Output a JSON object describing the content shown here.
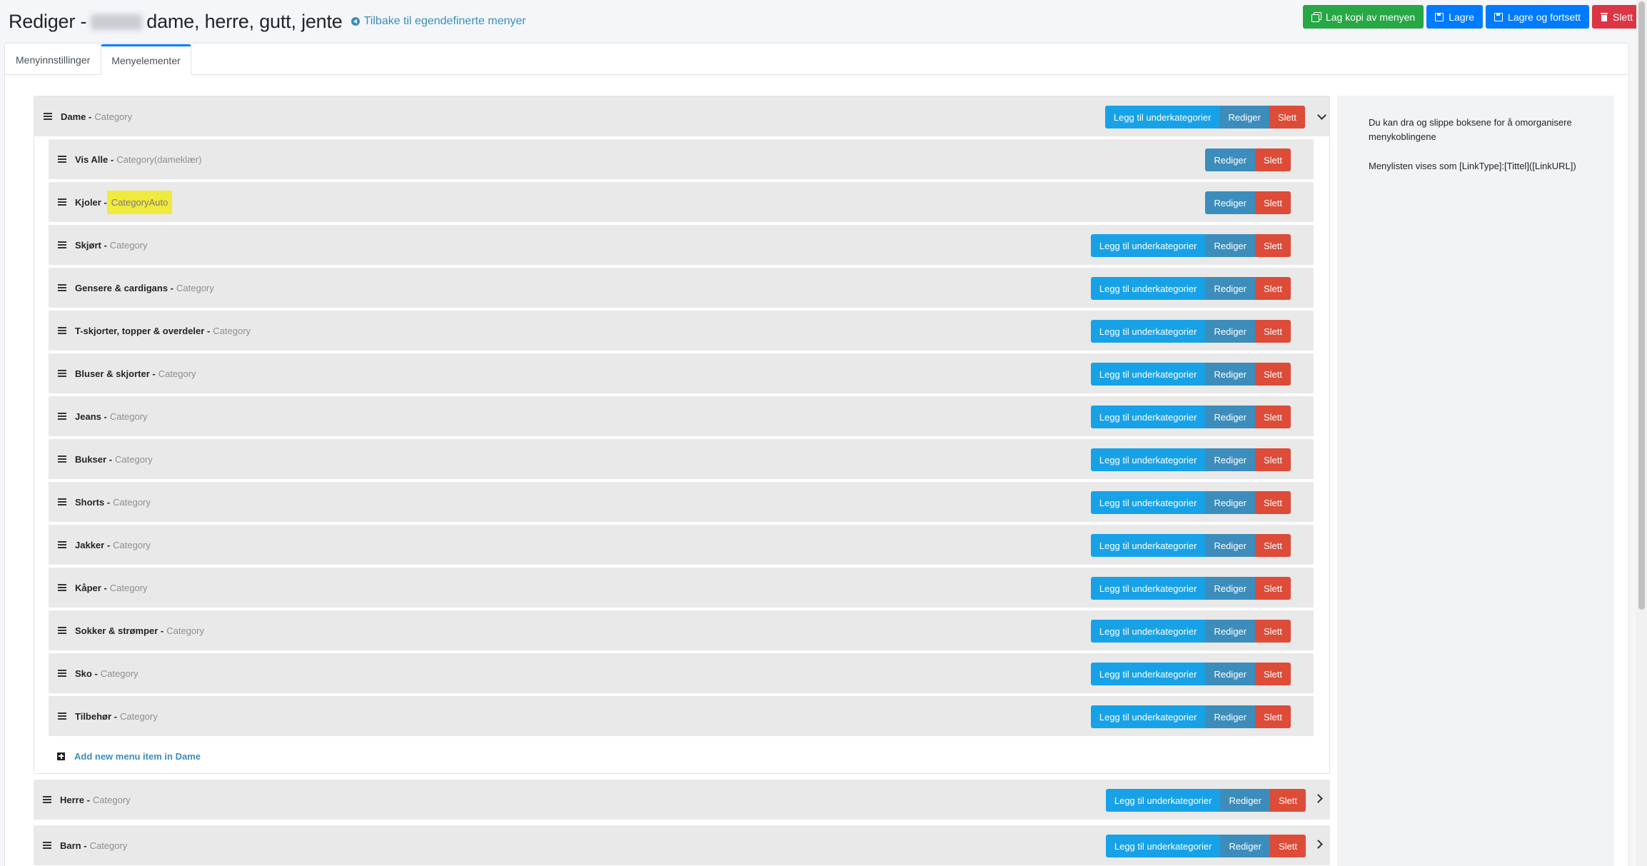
{
  "header": {
    "title_prefix": "Rediger -",
    "title_suffix": "dame, herre, gutt, jente",
    "back_link": "Tilbake til egendefinerte menyer",
    "actions": {
      "copy": "Lag kopi av menyen",
      "save": "Lagre",
      "save_continue": "Lagre og fortsett",
      "delete": "Slett"
    }
  },
  "tabs": [
    {
      "label": "Menyinnstillinger",
      "active": false
    },
    {
      "label": "Menyelementer",
      "active": true
    }
  ],
  "buttons": {
    "add_sub": "Legg til underkategorier",
    "edit": "Rediger",
    "delete": "Slett"
  },
  "menu": {
    "dame": {
      "name": "Dame -",
      "type": "Category",
      "children": [
        {
          "name": "Vis Alle -",
          "type": "Category(dameklær)",
          "can_add_sub": false
        },
        {
          "name": "Kjoler -",
          "type": "CategoryAuto",
          "can_add_sub": false,
          "highlight": true
        },
        {
          "name": "Skjørt -",
          "type": "Category",
          "can_add_sub": true
        },
        {
          "name": "Gensere & cardigans -",
          "type": "Category",
          "can_add_sub": true
        },
        {
          "name": "T-skjorter, topper & overdeler -",
          "type": "Category",
          "can_add_sub": true
        },
        {
          "name": "Bluser & skjorter -",
          "type": "Category",
          "can_add_sub": true
        },
        {
          "name": "Jeans -",
          "type": "Category",
          "can_add_sub": true
        },
        {
          "name": "Bukser -",
          "type": "Category",
          "can_add_sub": true
        },
        {
          "name": "Shorts -",
          "type": "Category",
          "can_add_sub": true
        },
        {
          "name": "Jakker -",
          "type": "Category",
          "can_add_sub": true
        },
        {
          "name": "Kåper -",
          "type": "Category",
          "can_add_sub": true
        },
        {
          "name": "Sokker & strømper -",
          "type": "Category",
          "can_add_sub": true
        },
        {
          "name": "Sko -",
          "type": "Category",
          "can_add_sub": true
        },
        {
          "name": "Tilbehør -",
          "type": "Category",
          "can_add_sub": true
        }
      ],
      "add_new": "Add new menu item in Dame"
    },
    "herre": {
      "name": "Herre -",
      "type": "Category"
    },
    "barn": {
      "name": "Barn -",
      "type": "Category"
    }
  },
  "side_panel": {
    "help_1": "Du kan dra og slippe boksene for å omorganisere menykoblingene",
    "help_2": "Menylisten vises som [LinkType]:[Tittel]([LinkURL])"
  },
  "colors": {
    "add_sub": "#17a2e8",
    "edit": "#3c8dbc",
    "delete": "#dd4b39",
    "highlight": "#f0ea3d"
  }
}
